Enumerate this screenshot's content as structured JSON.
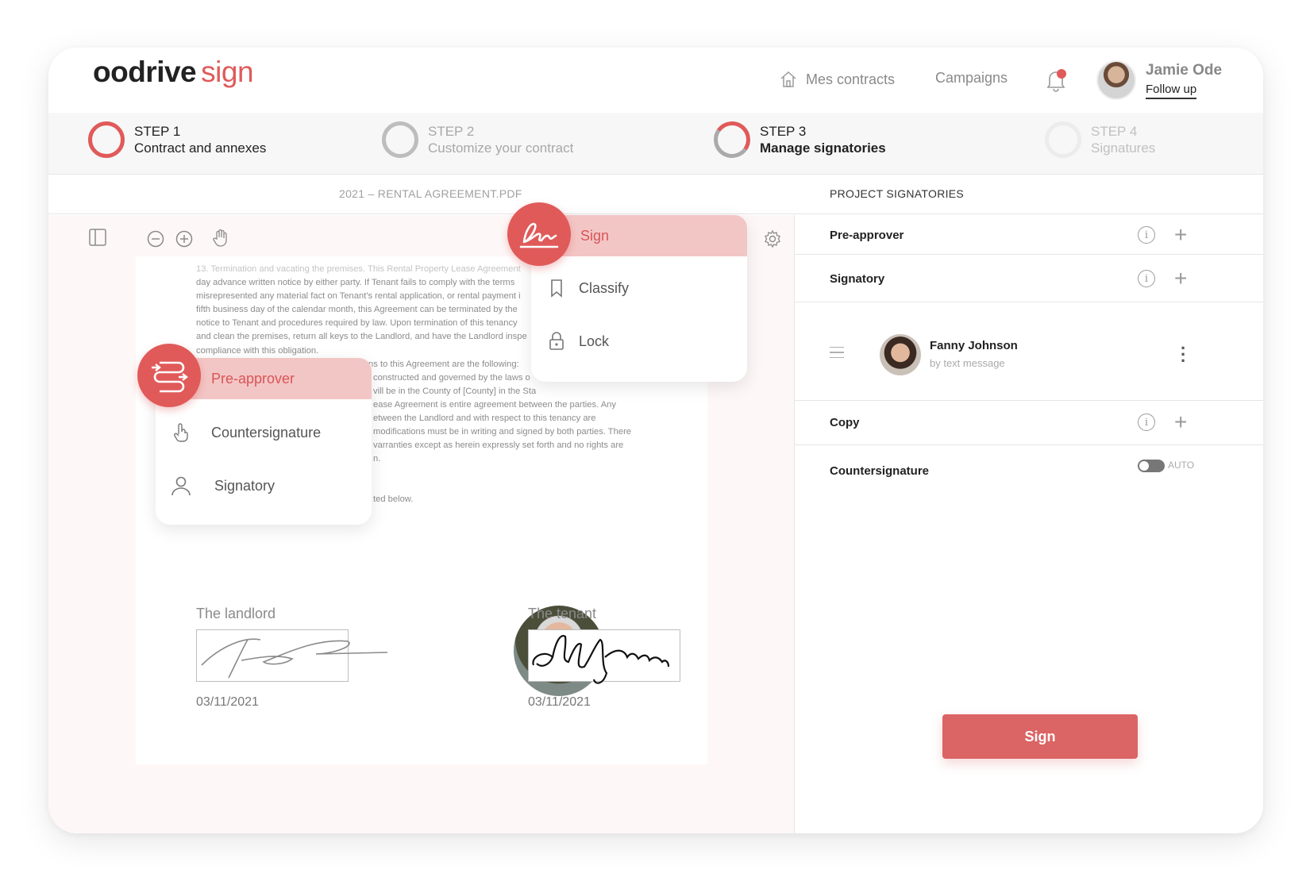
{
  "header": {
    "logo_brand": "oodrive",
    "logo_product": "sign",
    "nav_contracts": "Mes contracts",
    "nav_campaigns": "Campaigns",
    "user_name": "Jamie Ode",
    "user_link": "Follow up"
  },
  "steps": [
    {
      "num": "STEP 1",
      "title": "Contract and annexes"
    },
    {
      "num": "STEP 2",
      "title": "Customize your contract"
    },
    {
      "num": "STEP 3",
      "title": "Manage signatories"
    },
    {
      "num": "STEP 4",
      "title": "Signatures"
    }
  ],
  "document": {
    "filename": "2021 – RENTAL AGREEMENT.PDF",
    "lines": [
      "13. Termination and vacating the premises.  This Rental Property Lease Agreement",
      "day advance written notice by either party.  If Tenant fails to comply with the terms",
      "misrepresented any material fact on Tenant's rental application, or rental payment i",
      "fifth business day of the calendar month, this Agreement can be terminated by the",
      "notice to Tenant and procedures required by law.  Upon termination of this tenancy",
      "and clean the premises, return all keys to the Landlord, and have the Landlord inspe",
      "compliance with this obligation.",
      "14. Additional provisions.  Additional provisions to this Agreement are the following:",
      "constructed and governed by the laws o",
      "vill be in the County of [County] in the Sta",
      "ease Agreement is entire agreement between the parties.  Any",
      "etween the Landlord and with respect to this tenancy are",
      "modifications must be in writing and signed by both parties. There",
      "varranties except as herein expressly set forth and no rights are",
      "n.",
      "ted below."
    ],
    "landlord_label": "The landlord",
    "landlord_date": "03/11/2021",
    "tenant_label": "The tenant",
    "tenant_date": "03/11/2021"
  },
  "menu_sign": {
    "items": [
      "Sign",
      "Classify",
      "Lock"
    ]
  },
  "menu_role": {
    "items": [
      "Pre-approver",
      "Countersignature",
      "Signatory"
    ]
  },
  "signatories": {
    "title": "PROJECT SIGNATORIES",
    "pre_approver": "Pre-approver",
    "signatory": "Signatory",
    "person_name": "Fanny Johnson",
    "person_sub": "by text message",
    "copy": "Copy",
    "countersignature": "Countersignature",
    "auto_label": "AUTO",
    "sign_button": "Sign"
  },
  "colors": {
    "accent": "#e05a5a",
    "accent_light": "#f3c6c6"
  }
}
